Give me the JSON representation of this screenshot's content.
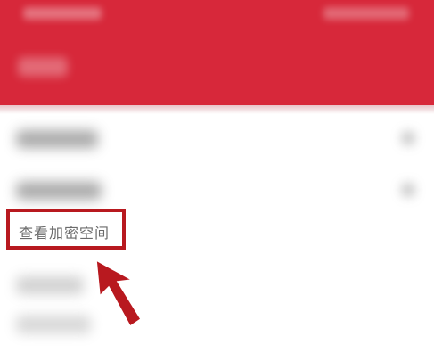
{
  "header": {
    "title": "",
    "background": "#d7283a"
  },
  "status_bar": {
    "time": "",
    "icons": ""
  },
  "menu": {
    "items": [
      {
        "label": "",
        "blurred": true,
        "has_chevron": true
      },
      {
        "label": "",
        "blurred": true,
        "has_chevron": true
      },
      {
        "label": "查看加密空间",
        "blurred": false,
        "highlighted": true
      },
      {
        "label": "",
        "blurred": true
      },
      {
        "label": "",
        "blurred": true
      }
    ]
  },
  "annotation": {
    "highlight_color": "#b8191f",
    "arrow_color": "#b8191f",
    "arrow_icon": "pointer-arrow-icon"
  }
}
